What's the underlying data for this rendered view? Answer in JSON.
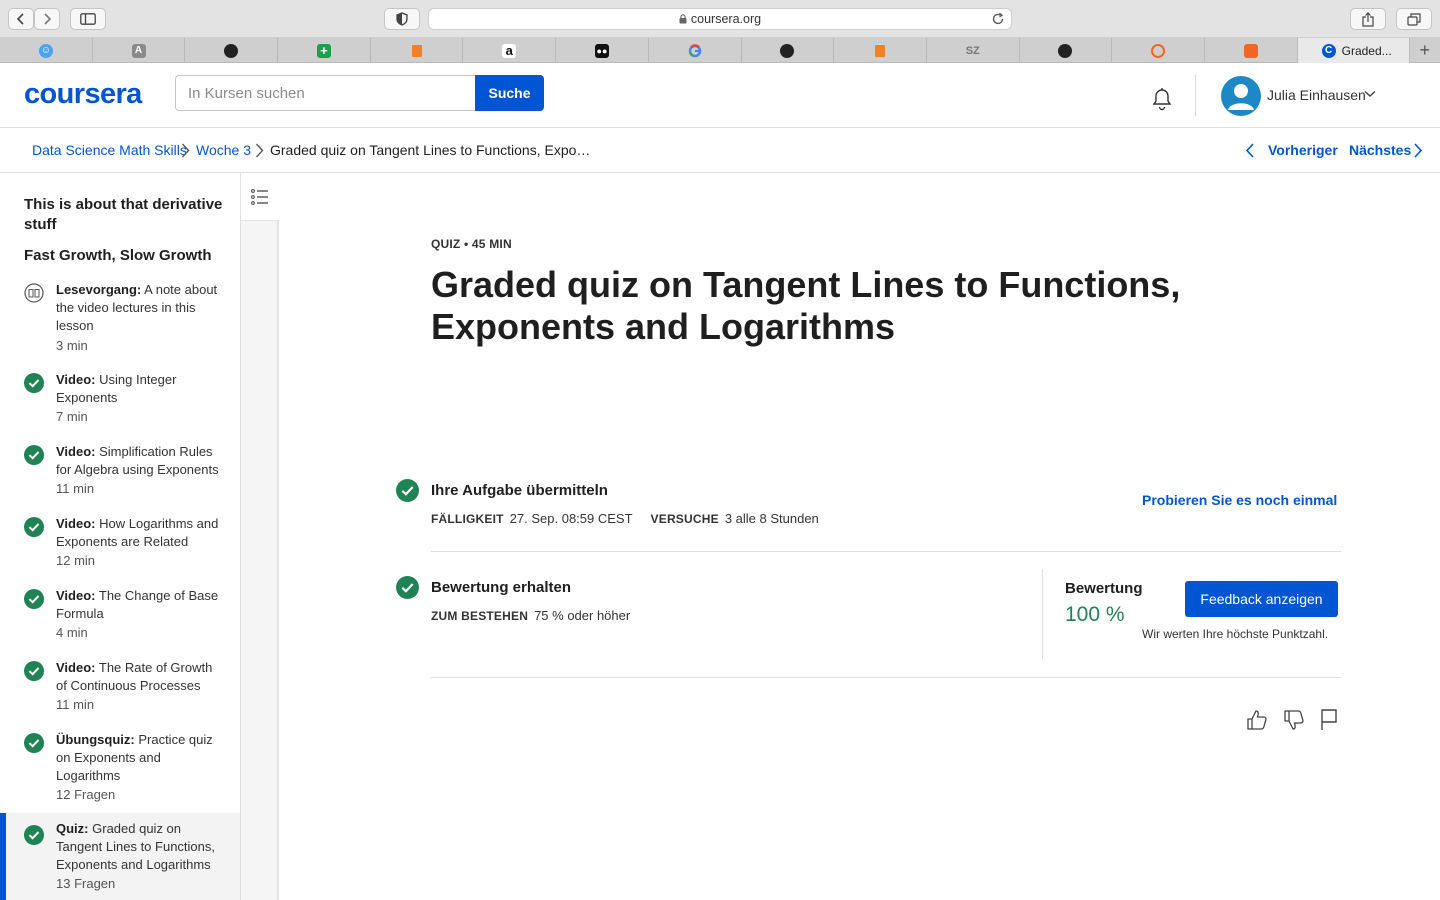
{
  "browser": {
    "url": "coursera.org",
    "active_tab_title": "Graded...",
    "tab_favicons": [
      "smiley-icon",
      "font-a-icon",
      "github-icon",
      "green-plus-icon",
      "stack-icon",
      "amazon-icon",
      "medium-icon",
      "google-icon",
      "github-icon",
      "stack-icon",
      "sz-icon",
      "github-icon",
      "orange-ring-icon",
      "orange-book-icon"
    ],
    "tab_letters": {
      "sz": "SZ",
      "a": "A",
      "amazon": "a"
    }
  },
  "header": {
    "logo": "coursera",
    "search_placeholder": "In Kursen suchen",
    "search_button": "Suche",
    "user_name": "Julia Einhausen"
  },
  "breadcrumb": {
    "items": [
      "Data Science Math Skills",
      "Woche 3",
      "Graded quiz on Tangent Lines to Functions, Expo…"
    ],
    "prev": "Vorheriger",
    "next": "Nächstes"
  },
  "sidebar": {
    "module_title": "This is about that derivative stuff",
    "lesson_title": "Fast Growth, Slow Growth",
    "items": [
      {
        "type": "Lesevorgang:",
        "title": "A note about the video lectures in this lesson",
        "duration": "3 min",
        "status": "reading"
      },
      {
        "type": "Video:",
        "title": "Using Integer Exponents",
        "duration": "7 min",
        "status": "done"
      },
      {
        "type": "Video:",
        "title": "Simplification Rules for Algebra using Exponents",
        "duration": "11 min",
        "status": "done"
      },
      {
        "type": "Video:",
        "title": "How Logarithms and Exponents are Related",
        "duration": "12 min",
        "status": "done"
      },
      {
        "type": "Video:",
        "title": "The Change of Base Formula",
        "duration": "4 min",
        "status": "done"
      },
      {
        "type": "Video:",
        "title": "The Rate of Growth of Continuous Processes",
        "duration": "11 min",
        "status": "done"
      },
      {
        "type": "Übungsquiz:",
        "title": "Practice quiz on Exponents and Logarithms",
        "duration": "12 Fragen",
        "status": "done"
      },
      {
        "type": "Quiz:",
        "title": "Graded quiz on Tangent Lines to Functions, Exponents and Logarithms",
        "duration": "13 Fragen",
        "status": "done"
      }
    ]
  },
  "main": {
    "meta": "QUIZ • 45 MIN",
    "title": "Graded quiz on Tangent Lines to Functions, Exponents and Logarithms",
    "submit": {
      "heading": "Ihre Aufgabe übermitteln",
      "due_label": "FÄLLIGKEIT",
      "due_value": "27. Sep. 08:59 CEST",
      "attempts_label": "VERSUCHE",
      "attempts_value": "3 alle 8 Stunden",
      "retry": "Probieren Sie es noch einmal"
    },
    "grade": {
      "heading": "Bewertung erhalten",
      "pass_label": "ZUM BESTEHEN",
      "pass_value": "75 % oder höher",
      "grade_label": "Bewertung",
      "grade_value": "100 %",
      "feedback_button": "Feedback anzeigen",
      "note": "Wir werten Ihre höchste Punktzahl."
    }
  },
  "colors": {
    "accent": "#0056d2",
    "success": "#1f8354",
    "check": "#1f8354"
  }
}
